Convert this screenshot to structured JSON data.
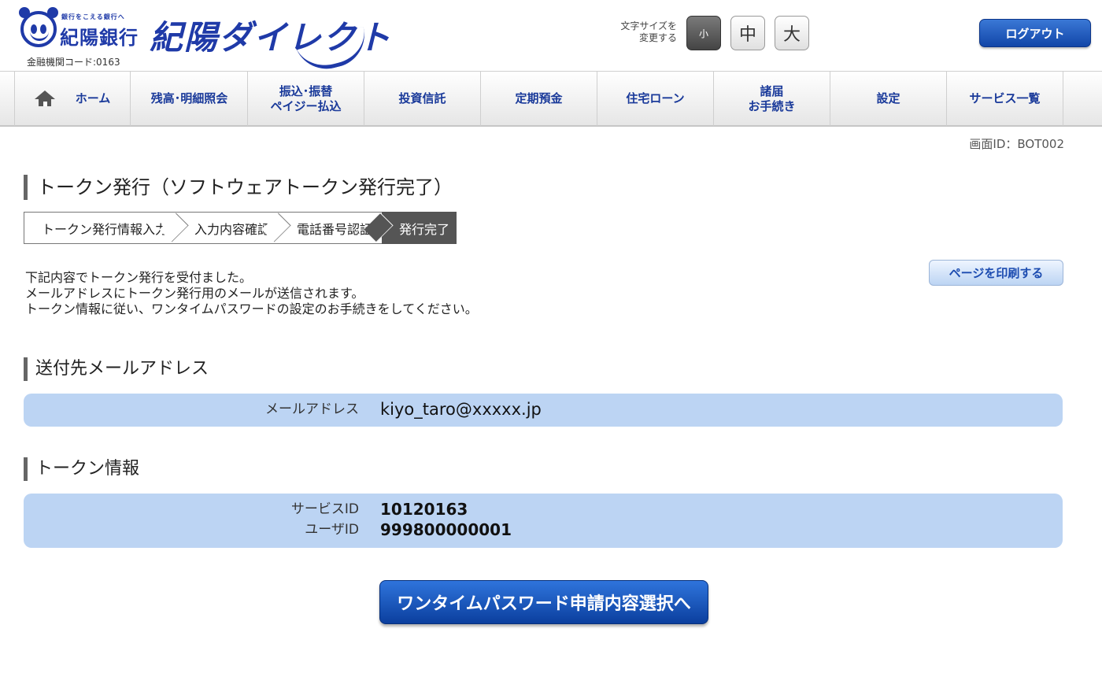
{
  "header": {
    "bank_tagline": "銀行をこえる銀行へ",
    "bank_name": "紀陽銀行",
    "bank_code": "金融機関コード:0163",
    "service_name": "紀陽ダイレクト",
    "font_size_label_1": "文字サイズを",
    "font_size_label_2": "変更する",
    "font_small": "小",
    "font_medium": "中",
    "font_large": "大",
    "logout": "ログアウト"
  },
  "nav": {
    "home": "ホーム",
    "balance": "残高･明細照会",
    "transfer_1": "振込･振替",
    "transfer_2": "ペイジー払込",
    "investment": "投資信託",
    "deposit": "定期預金",
    "housing_loan": "住宅ローン",
    "procedures_1": "諸届",
    "procedures_2": "お手続き",
    "settings": "設定",
    "services": "サービス一覧"
  },
  "main": {
    "screen_id": "画面ID：BOT002",
    "page_title": "トークン発行（ソフトウェアトークン発行完了）",
    "steps": [
      "トークン発行情報入力",
      "入力内容確認",
      "電話番号認証",
      "発行完了"
    ],
    "message_1": "下記内容でトークン発行を受付ました。",
    "message_2": "メールアドレスにトークン発行用のメールが送信されます。",
    "message_3": "トークン情報に従い、ワンタイムパスワードの設定のお手続きをしてください。",
    "print_button": "ページを印刷する",
    "mail_section_title": "送付先メールアドレス",
    "mail_label": "メールアドレス",
    "mail_value": "kiyo_taro@xxxxx.jp",
    "token_section_title": "トークン情報",
    "service_id_label": "サービスID",
    "service_id_value": "10120163",
    "user_id_label": "ユーザID",
    "user_id_value": "999800000001",
    "otp_button": "ワンタイムパスワード申請内容選択へ"
  },
  "colors": {
    "brand_blue": "#1f3aa8",
    "nav_text": "#1a3a9a",
    "info_box": "#bcd4f3",
    "active_step": "#555555"
  }
}
